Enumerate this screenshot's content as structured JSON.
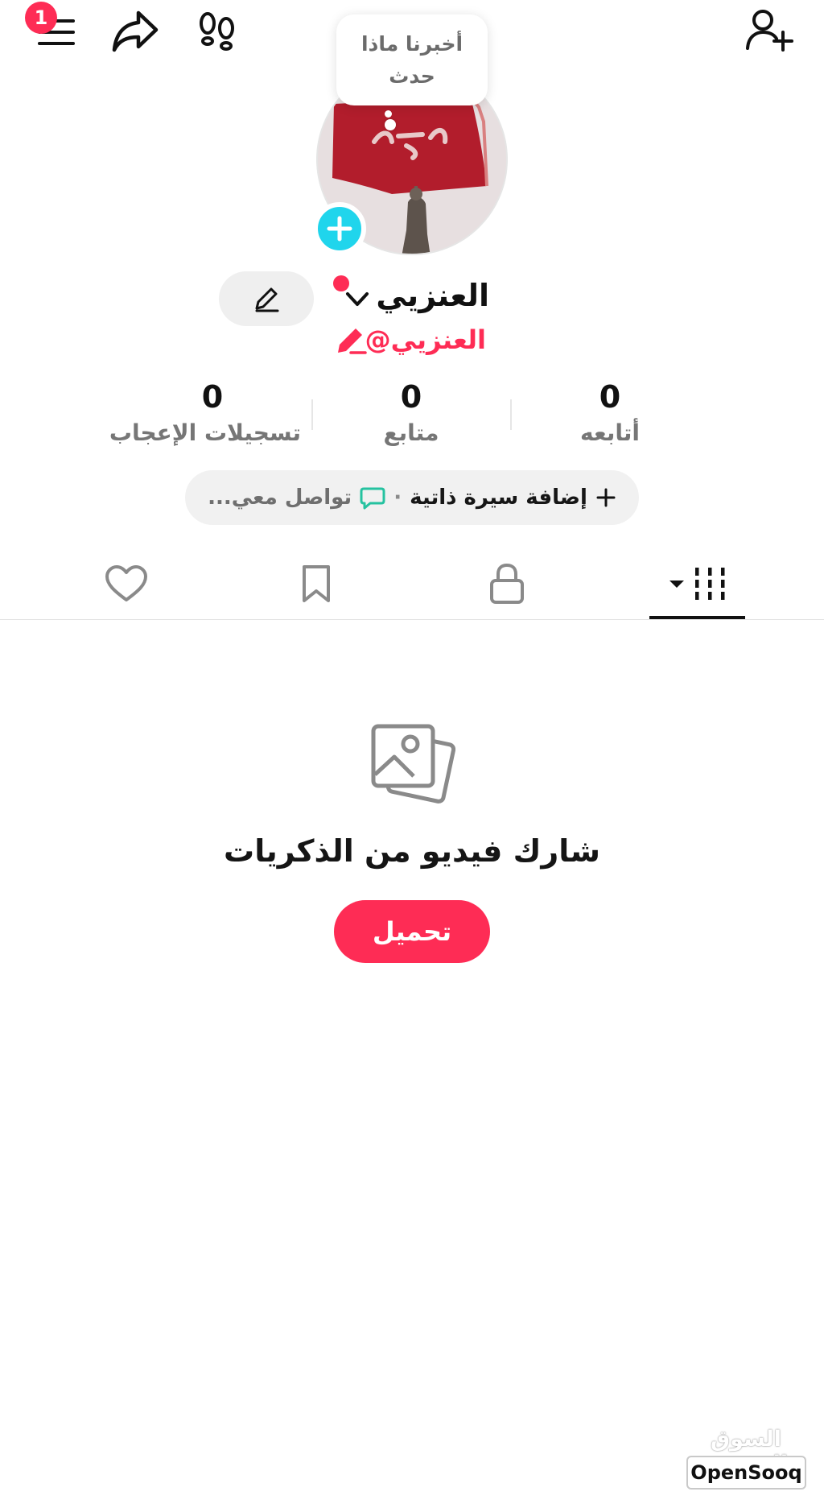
{
  "header": {
    "notification_count": "1",
    "icons": [
      "menu-icon",
      "share-icon",
      "footprints-icon",
      "add-friend-icon"
    ]
  },
  "tooltip": {
    "text": "أخبرنا ماذا حدث"
  },
  "profile": {
    "name": "العنزيي",
    "handle": "@العنزيي"
  },
  "stats": [
    {
      "value": "0",
      "label": "أتابعه"
    },
    {
      "value": "0",
      "label": "متابع"
    },
    {
      "value": "0",
      "label": "تسجيلات الإعجاب"
    }
  ],
  "bio": {
    "add_label": "إضافة سيرة ذاتية",
    "separator": "·",
    "contact_label": "تواصل معي..."
  },
  "tabs": [
    "videos-grid",
    "private-lock",
    "saved-bookmark",
    "liked-heart"
  ],
  "empty_state": {
    "title": "شارك فيديو من الذكريات",
    "button_label": "تحميل"
  },
  "watermark": {
    "arabic": "السوق المفتوح",
    "english": "OpenSooq"
  },
  "colors": {
    "accent": "#fe2c55",
    "cyan": "#20d5ec",
    "contact_icon": "#25c2a0"
  }
}
